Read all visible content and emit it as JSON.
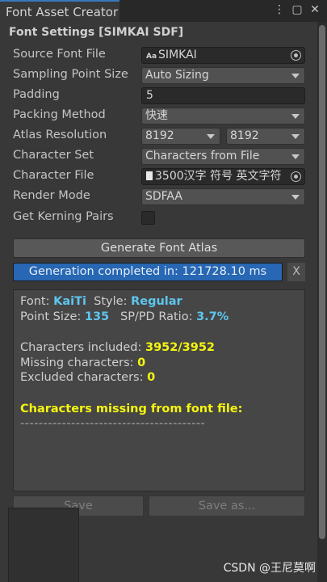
{
  "window": {
    "tab_title": "Font Asset Creator",
    "icons": [
      "more-vertical-icon",
      "maximize-icon",
      "close-icon"
    ]
  },
  "settings": {
    "section_title": "Font Settings [SIMKAI SDF]",
    "source_font_file": {
      "label": "Source Font File",
      "value": "SIMKAI",
      "prefix": "Aa"
    },
    "sampling_point_size": {
      "label": "Sampling Point Size",
      "value": "Auto Sizing"
    },
    "padding": {
      "label": "Padding",
      "value": "5"
    },
    "packing_method": {
      "label": "Packing Method",
      "value": "快速"
    },
    "atlas_resolution": {
      "label": "Atlas Resolution",
      "width": "8192",
      "height": "8192"
    },
    "character_set": {
      "label": "Character Set",
      "value": "Characters from File"
    },
    "character_file": {
      "label": "Character File",
      "value": "3500汉字 符号 英文字符"
    },
    "render_mode": {
      "label": "Render Mode",
      "value": "SDFAA"
    },
    "get_kerning_pairs": {
      "label": "Get Kerning Pairs",
      "checked": false
    }
  },
  "actions": {
    "generate_label": "Generate Font Atlas",
    "progress_text": "Generation completed in: 121728.10 ms",
    "progress_fraction": 1.0,
    "dismiss_label": "X",
    "save_label": "Save",
    "save_as_label": "Save as..."
  },
  "info": {
    "font_label": "Font:",
    "font_value": "KaiTi",
    "style_label": "Style:",
    "style_value": "Regular",
    "point_size_label": "Point Size:",
    "point_size_value": "135",
    "ratio_label": "SP/PD Ratio:",
    "ratio_value": "3.7%",
    "chars_included_label": "Characters included:",
    "chars_included_value": "3952/3952",
    "missing_label": "Missing characters:",
    "missing_value": "0",
    "excluded_label": "Excluded characters:",
    "excluded_value": "0",
    "missing_header": "Characters missing from font file:",
    "divider": "----------------------------------------"
  },
  "watermark": "CSDN @王尼莫啊",
  "colors": {
    "accent_blue": "#2767b3",
    "value_cyan": "#5ec6ee",
    "highlight_yellow": "#f5f510",
    "panel_bg": "#383838"
  }
}
